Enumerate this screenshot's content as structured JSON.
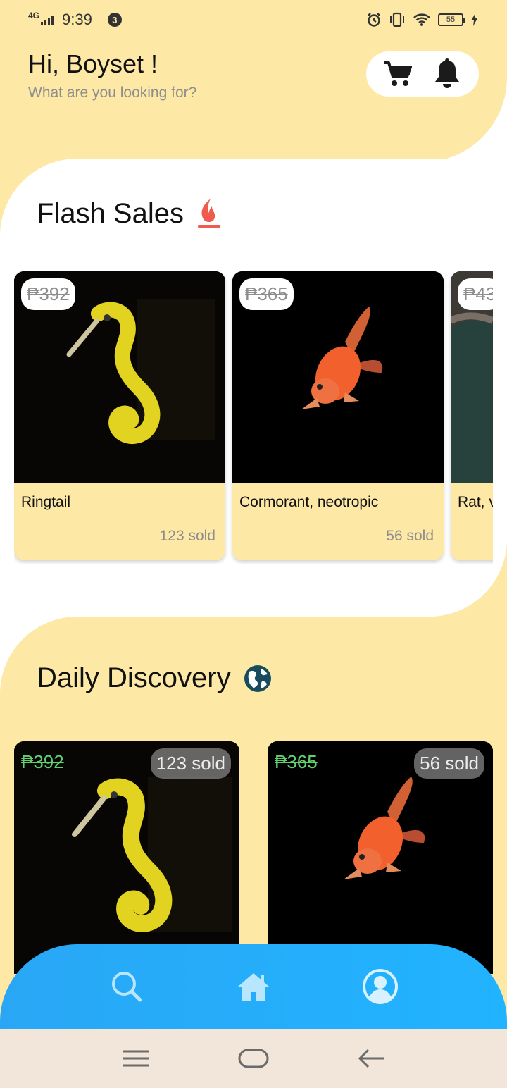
{
  "status_bar": {
    "network": "4G",
    "time": "9:39",
    "notification_count": "3",
    "battery": "55"
  },
  "header": {
    "greeting": "Hi, Boyset !",
    "subtitle": "What are you looking for?",
    "cart_icon": "cart-icon",
    "bell_icon": "bell-icon"
  },
  "flash_sales": {
    "title": "Flash Sales",
    "icon": "fire-icon",
    "items": [
      {
        "price": "₱392",
        "name": "Ringtail",
        "sold": "123 sold",
        "image": "seahorse"
      },
      {
        "price": "₱365",
        "name": "Cormorant, neotropic",
        "sold": "56 sold",
        "image": "goldfish"
      },
      {
        "price": "₱43",
        "name": "Rat, v",
        "sold": "",
        "image": "rock"
      }
    ]
  },
  "daily_discovery": {
    "title": "Daily Discovery",
    "icon": "globe-icon",
    "items": [
      {
        "price": "₱392",
        "sold": "123 sold",
        "image": "seahorse"
      },
      {
        "price": "₱365",
        "sold": "56 sold",
        "image": "goldfish"
      }
    ]
  },
  "bottom_nav": {
    "items": [
      "search-icon",
      "home-icon",
      "profile-icon"
    ]
  },
  "colors": {
    "yellow": "#fde8a6",
    "nav_blue": "#21b3ff",
    "price_green": "#5fd16d",
    "fire": "#ef5b4c",
    "globe": "#174c5f"
  }
}
